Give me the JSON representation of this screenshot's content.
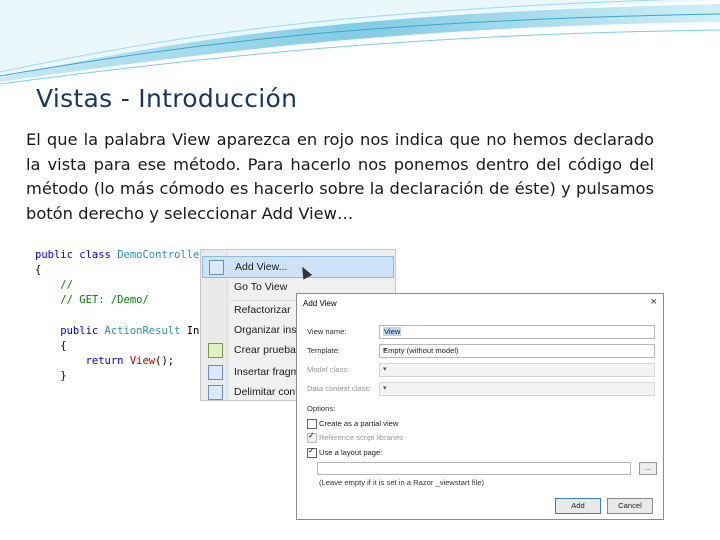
{
  "slide": {
    "title": "Vistas - Introducción",
    "body": "El que la palabra View aparezca en rojo nos indica que no hemos declarado la vista para ese método. Para hacerlo nos ponemos dentro del código del método (lo más cómodo es hacerlo sobre la declaración de éste) y pulsamos botón derecho  y seleccionar Add View…"
  },
  "code": {
    "line1_kw": "public class ",
    "line1_type": "DemoControlle",
    "line2": "{",
    "line3": "    //",
    "line4": "    // GET: /Demo/",
    "line6_kw": "    public ",
    "line6_type": "ActionResult ",
    "line6_rest": "In",
    "line7": "    {",
    "line8_kw": "        return ",
    "line8_red": "View",
    "line8_rest": "();",
    "line9": "    }"
  },
  "context_menu": {
    "items": [
      {
        "label": "Add View..."
      },
      {
        "label": "Go To View"
      },
      {
        "label": "Refactorizar"
      },
      {
        "label": "Organizar inst"
      },
      {
        "label": "Crear pruebas"
      },
      {
        "label": "Insertar fragm"
      },
      {
        "label": "Delimitar con"
      }
    ]
  },
  "dialog": {
    "title": "Add View",
    "close": "×",
    "view_name_label": "View name:",
    "view_name_value": "View",
    "template_label": "Template:",
    "template_value": "Empty (without model)",
    "model_class_label": "Model class:",
    "data_context_label": "Data context class:",
    "options_label": "Options:",
    "create_partial": "Create as a partial view",
    "reference_scripts": "Reference script libraries",
    "use_layout": "Use a layout page:",
    "browse": "...",
    "layout_hint": "(Leave empty if it is set in a Razor _viewstart file)",
    "add_button": "Add",
    "cancel_button": "Cancel"
  },
  "colors": {
    "title": "#17375e",
    "keyword": "#0000ff",
    "type": "#2b91af",
    "comment": "#008000",
    "error": "#c00000",
    "swoosh": "#5ab4d6"
  }
}
